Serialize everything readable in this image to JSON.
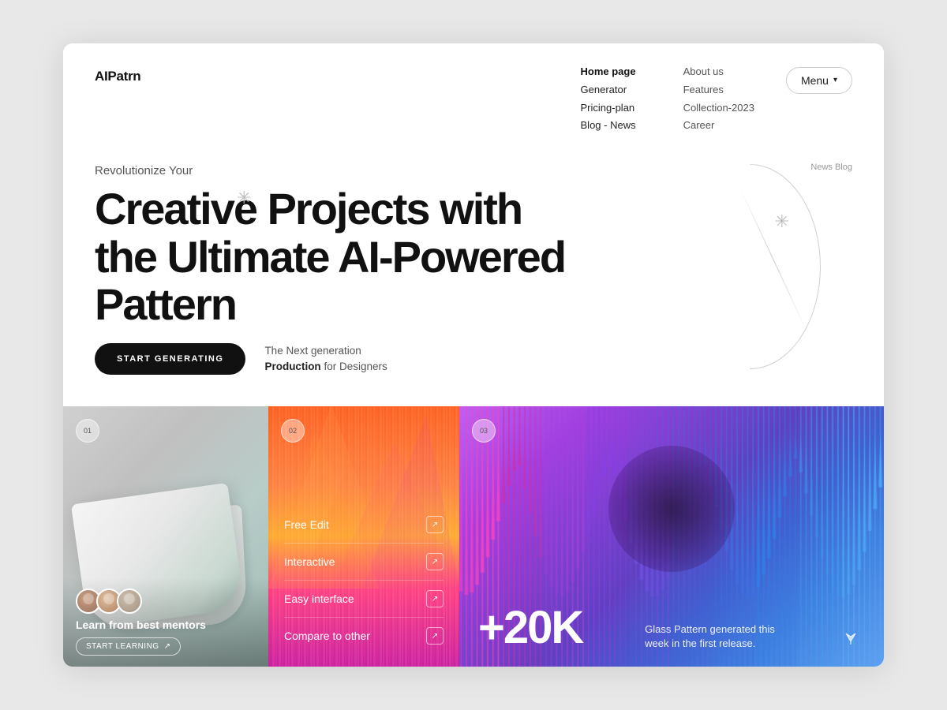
{
  "brand": {
    "logo": "AIPatrn"
  },
  "nav": {
    "left": [
      {
        "label": "Home page",
        "active": true
      },
      {
        "label": "Generator",
        "active": false
      },
      {
        "label": "Pricing-plan",
        "active": false
      },
      {
        "label": "Blog - News",
        "active": false
      }
    ],
    "right": [
      {
        "label": "About us"
      },
      {
        "label": "Features"
      },
      {
        "label": "Collection-2023"
      },
      {
        "label": "Career"
      }
    ],
    "menu_btn": "Menu",
    "news_blog": "News Blog"
  },
  "hero": {
    "subtitle": "Revolutionize Your",
    "title_line1": "Creative Projects with",
    "title_line2": "the Ultimate AI-Powered",
    "title_line3": "Pattern",
    "cta_btn": "START GENERATING",
    "desc_line1": "The Next generation",
    "desc_bold": "Production",
    "desc_line2": "for Designers"
  },
  "cards": [
    {
      "number": "01",
      "label": "Learn from best mentors",
      "btn": "START LEARNING",
      "btn_arrow": "↗"
    },
    {
      "number": "02",
      "menu_items": [
        {
          "label": "Free Edit",
          "arrow": "↗"
        },
        {
          "label": "Interactive",
          "arrow": "↗"
        },
        {
          "label": "Easy interface",
          "arrow": "↗"
        },
        {
          "label": "Compare to other",
          "arrow": "↗"
        }
      ]
    },
    {
      "number": "03",
      "stat": "+20K",
      "desc": "Glass Pattern generated this week in the first release."
    }
  ]
}
